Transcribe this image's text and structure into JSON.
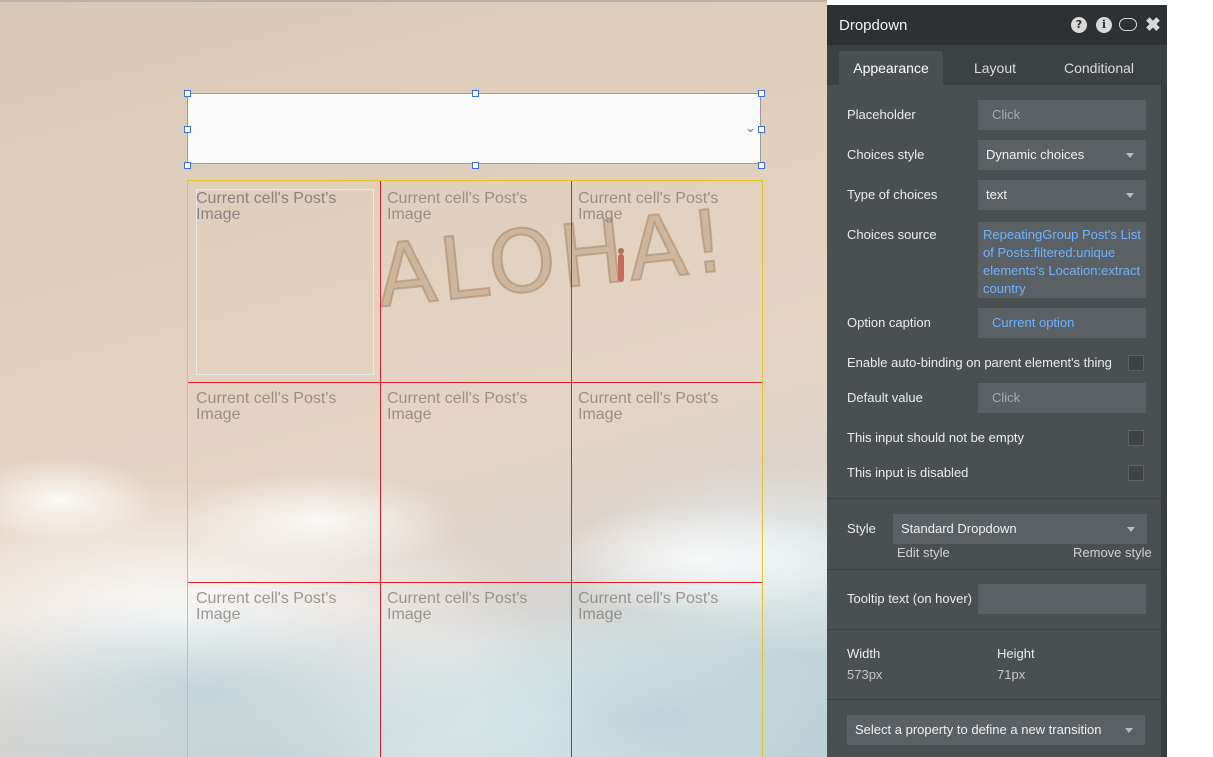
{
  "panel": {
    "title": "Dropdown",
    "tabs": [
      {
        "label": "Appearance",
        "active": true
      },
      {
        "label": "Layout",
        "active": false
      },
      {
        "label": "Conditional",
        "active": false
      }
    ],
    "header_icons": [
      "help-icon",
      "info-icon",
      "comment-icon",
      "close-icon"
    ],
    "help_glyph": "?",
    "info_glyph": "i",
    "close_glyph": "✖"
  },
  "properties": {
    "placeholder": {
      "label": "Placeholder",
      "value": "Click"
    },
    "choices_style": {
      "label": "Choices style",
      "value": "Dynamic choices"
    },
    "type_of_choices": {
      "label": "Type of choices",
      "value": "text"
    },
    "choices_source": {
      "label": "Choices source",
      "value": "RepeatingGroup Post's List of Posts:filtered:unique elements's Location:extract country"
    },
    "option_caption": {
      "label": "Option caption",
      "value": "Current option"
    },
    "auto_binding": {
      "label": "Enable auto-binding on parent element's thing",
      "checked": false
    },
    "default_value": {
      "label": "Default value",
      "value": "Click"
    },
    "not_empty": {
      "label": "This input should not be empty",
      "checked": false
    },
    "disabled": {
      "label": "This input is disabled",
      "checked": false
    },
    "style": {
      "label": "Style",
      "value": "Standard Dropdown",
      "edit_label": "Edit style",
      "remove_label": "Remove style"
    },
    "tooltip": {
      "label": "Tooltip text (on hover)",
      "value": ""
    },
    "width": {
      "label": "Width",
      "value": "573px"
    },
    "height": {
      "label": "Height",
      "value": "71px"
    },
    "transition": {
      "placeholder": "Select a property to define a new transition"
    }
  },
  "canvas": {
    "sand_text": "ALOHA!",
    "dropdown_chevron": "⌄",
    "repeating_group": {
      "cells": [
        "Current cell's Post's Image",
        "Current cell's Post's Image",
        "Current cell's Post's Image",
        "Current cell's Post's Image",
        "Current cell's Post's Image",
        "Current cell's Post's Image",
        "Current cell's Post's Image",
        "Current cell's Post's Image",
        "Current cell's Post's Image"
      ]
    }
  },
  "colors": {
    "panel_bg": "#4a4f52",
    "panel_header": "#2d3134",
    "dynamic_text": "#6fb3ff",
    "selection_handle": "#3b6fd6",
    "group_border": "#e1c52a",
    "cell_divider": "#d8202b"
  }
}
